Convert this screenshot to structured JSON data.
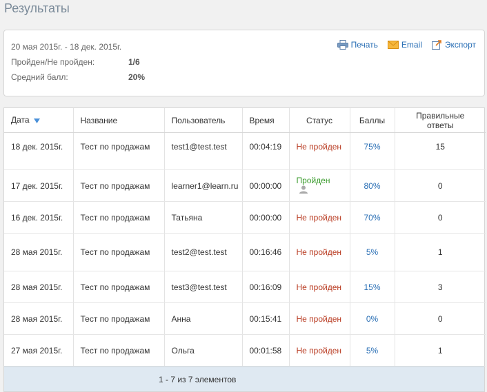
{
  "page": {
    "title": "Результаты"
  },
  "summary": {
    "date_range": "20 мая 2015г. - 18 дек. 2015г.",
    "passed_label": "Пройден/Не пройден:",
    "passed_value": "1/6",
    "avg_label": "Средний балл:",
    "avg_value": "20%"
  },
  "actions": {
    "print": "Печать",
    "email": "Email",
    "export": "Экспорт"
  },
  "table": {
    "columns": {
      "date": "Дата",
      "name": "Название",
      "user": "Пользователь",
      "time": "Время",
      "status": "Статус",
      "score": "Баллы",
      "correct": "Правильные ответы"
    },
    "rows": [
      {
        "date": "18 дек. 2015г.",
        "name": "Тест по продажам",
        "user": "test1@test.test",
        "time": "00:04:19",
        "status": "Не пройден",
        "score": "75%",
        "correct": "15"
      },
      {
        "date": "17 дек. 2015г.",
        "name": "Тест по продажам",
        "user": "learner1@learn.ru",
        "time": "00:00:00",
        "status": "Пройден",
        "score": "80%",
        "correct": "0"
      },
      {
        "date": "16 дек. 2015г.",
        "name": "Тест по продажам",
        "user": "Татьяна",
        "time": "00:00:00",
        "status": "Не пройден",
        "score": "70%",
        "correct": "0"
      },
      {
        "date": "28 мая 2015г.",
        "name": "Тест по продажам",
        "user": "test2@test.test",
        "time": "00:16:46",
        "status": "Не пройден",
        "score": "5%",
        "correct": "1"
      },
      {
        "date": "28 мая 2015г.",
        "name": "Тест по продажам",
        "user": "test3@test.test",
        "time": "00:16:09",
        "status": "Не пройден",
        "score": "15%",
        "correct": "3"
      },
      {
        "date": "28 мая 2015г.",
        "name": "Тест по продажам",
        "user": "Анна",
        "time": "00:15:41",
        "status": "Не пройден",
        "score": "0%",
        "correct": "0"
      },
      {
        "date": "27 мая 2015г.",
        "name": "Тест по продажам",
        "user": "Ольга",
        "time": "00:01:58",
        "status": "Не пройден",
        "score": "5%",
        "correct": "1"
      }
    ],
    "pager": "1 - 7 из 7 элементов"
  },
  "colors": {
    "fail": "#b8391f",
    "pass": "#3a9b2c",
    "link": "#2a6fb5"
  }
}
